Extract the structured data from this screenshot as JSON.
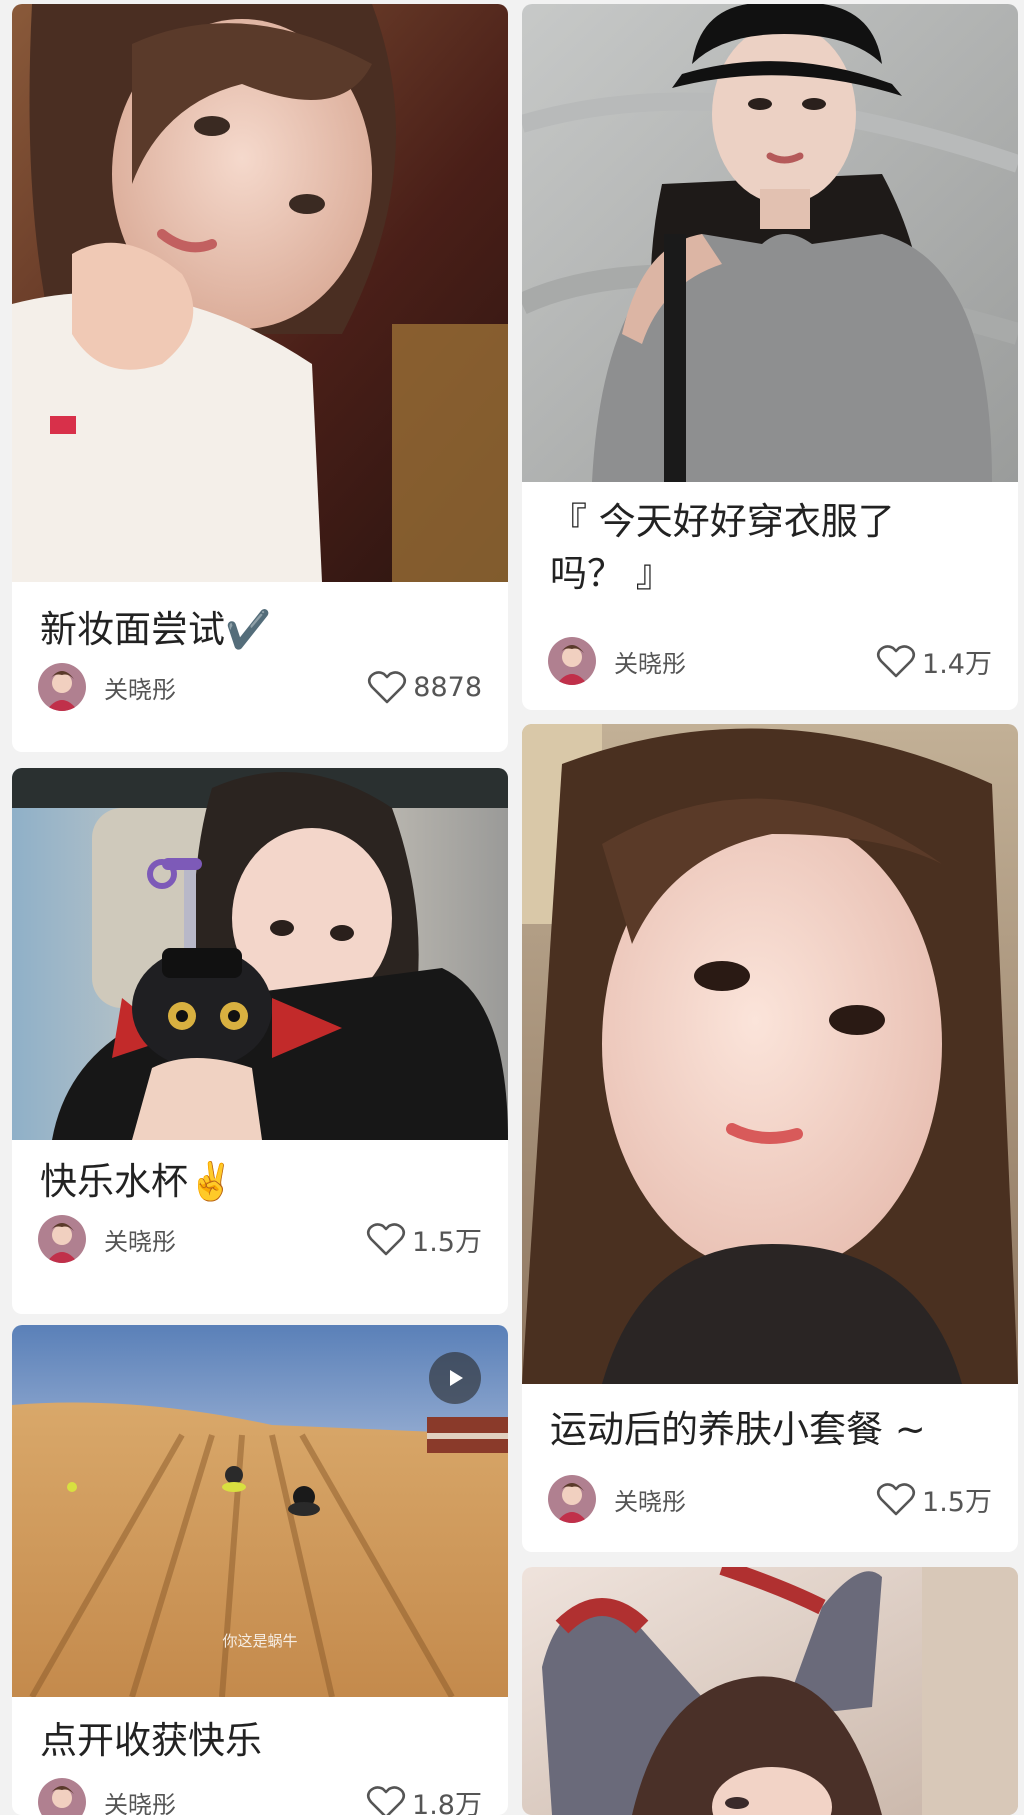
{
  "feed": {
    "cards": [
      {
        "title": "新妆面尝试✔️",
        "author": "关晓彤",
        "likes": "8878"
      },
      {
        "title": "『 今天好好穿衣服了吗？ 』",
        "title_line1": "『 今天好好穿衣服了",
        "title_line2": "吗？ 』",
        "author": "关晓彤",
        "likes": "1.4万"
      },
      {
        "title": "快乐水杯✌️",
        "author": "关晓彤",
        "likes": "1.5万"
      },
      {
        "title": "运动后的养肤小套餐 ~",
        "author": "关晓彤",
        "likes": "1.5万"
      },
      {
        "title": "点开收获快乐",
        "author": "关晓彤",
        "likes": "1.8万",
        "video_subtitle": "你这是蜗牛"
      },
      {
        "title": ""
      }
    ]
  },
  "colors": {
    "background": "#f2f2f2",
    "card": "#ffffff",
    "text_primary": "#222222",
    "text_secondary": "#555555"
  },
  "icons": [
    "heart-icon",
    "play-icon",
    "avatar"
  ]
}
